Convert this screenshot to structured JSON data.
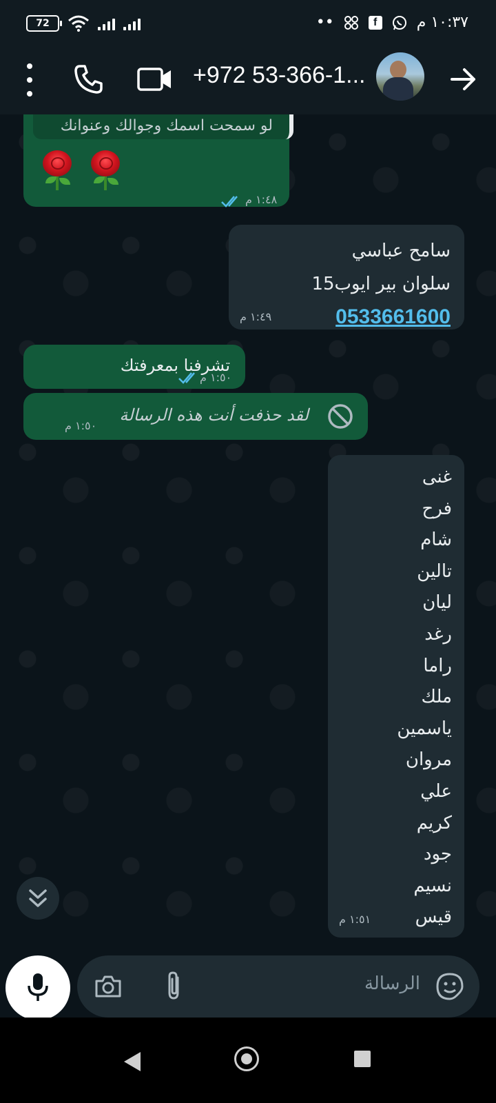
{
  "status_bar": {
    "battery": "72",
    "time": "١٠:٣٧ م",
    "dots": "••"
  },
  "header": {
    "contact_title": "+972 53-366-1..."
  },
  "messages": [
    {
      "direction": "incoming",
      "quoted_text": "لو سمحت اسمك وجوالك وعنوانك",
      "emoji": "🌹🌹",
      "time": "١:٤٨ م",
      "read": true
    },
    {
      "direction": "outgoing",
      "lines": [
        "سامح عباسي",
        "سلوان بير ايوب15"
      ],
      "phone": "0533661600",
      "time": "١:٤٩ م"
    },
    {
      "direction": "incoming",
      "text": "تشرفنا بمعرفتك",
      "time": "١:٥٠ م",
      "read": true
    },
    {
      "direction": "incoming",
      "deleted_text": "لقد حذفت أنت هذه الرسالة",
      "time": "١:٥٠ م"
    },
    {
      "direction": "outgoing",
      "names": [
        "غنى",
        "فرح",
        "شام",
        "تالين",
        "ليان",
        "رغد",
        "راما",
        "ملك",
        "ياسمين",
        "مروان",
        "علي",
        "كريم",
        "جود",
        "نسيم",
        "قيس"
      ],
      "time": "١:٥١ م"
    }
  ],
  "composer": {
    "placeholder": "الرسالة"
  },
  "colors": {
    "app_bar": "#111b21",
    "chat_bg": "#0b141a",
    "incoming_bubble": "#125a3a",
    "outgoing_bubble": "#1f2c33",
    "link": "#53bdeb",
    "read_ticks": "#53bdeb"
  },
  "icons": [
    "more-vert-icon",
    "phone-icon",
    "video-call-icon",
    "back-arrow-icon",
    "wifi-icon",
    "signal-icon",
    "whatsapp-icon",
    "facebook-icon",
    "chevron-double-down-icon",
    "mic-icon",
    "camera-icon",
    "attachment-icon",
    "sticker-icon",
    "blocked-icon"
  ]
}
